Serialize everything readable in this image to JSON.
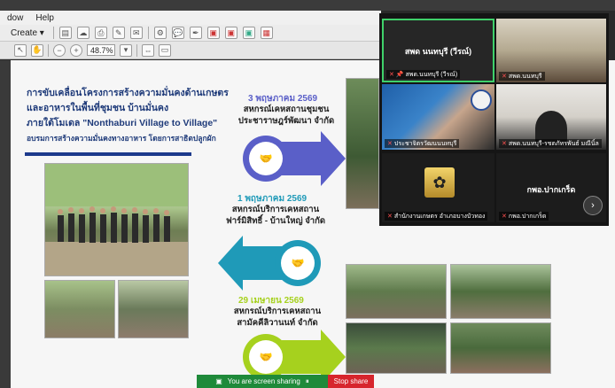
{
  "menu": [
    "dow",
    "Help"
  ],
  "toolbar": {
    "create_label": "Create ▾",
    "zoom": "48.7%"
  },
  "slide": {
    "title_lines": [
      "การขับเคลื่อนโครงการสร้างความมั่นคงด้านเกษตร",
      "และอาหารในพื้นที่ชุมชน บ้านมั่นคง",
      "ภายใต้โมเดล \"Nonthaburi Village to Village\""
    ],
    "subtitle": "อบรมการสร้างความมั่นคงทางอาหาร โดยการสาธิตปลูกผัก",
    "events": [
      {
        "date": "3 พฤษภาคม 2569",
        "lines": [
          "สหกรณ์เคหสถานชุมชน",
          "ประชาราษฎร์พัฒนา จำกัด"
        ]
      },
      {
        "date": "1 พฤษภาคม 2569",
        "lines": [
          "สหกรณ์บริการเคหสถาน",
          "ฟาร์มิสิทธิ์ - บ้านใหญ่ จำกัด"
        ]
      },
      {
        "date": "29 เมษายน 2569",
        "lines": [
          "สหกรณ์บริการเคหสถาน",
          "สามัคคีลิวานนท์ จำกัด"
        ]
      }
    ],
    "colors": {
      "arrow_blue": "#5a5fc8",
      "arrow_teal": "#1f9ab8",
      "arrow_green": "#a6d11e",
      "title_blue": "#1f3b7a"
    }
  },
  "meeting": {
    "tiles": [
      {
        "label": "สพด นนทบุรี (วีรณ์)",
        "sub": "สพด.นนทบุรี (วีรณ์)"
      },
      {
        "label": "สพด.นนทบุรี"
      },
      {
        "label": "ประชาจิตรวัฒนนนทบุรี"
      },
      {
        "label": "สพด.นนทบุรี-รชตภัทรพันธ์ มณีนิ์ล"
      },
      {
        "label": "สำนักงานเกษตร อำเภอบางบัวทอง"
      },
      {
        "label": "กพอ.ปากเกร็ด",
        "sub": "กพอ.ปากเกร็ด"
      }
    ]
  },
  "sharebar": {
    "status": "You are screen sharing",
    "stop": "Stop share"
  }
}
